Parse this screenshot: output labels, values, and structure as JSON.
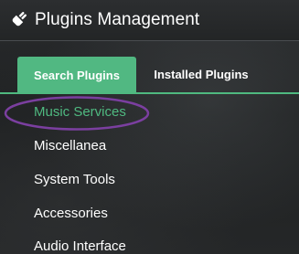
{
  "header": {
    "title": "Plugins Management",
    "icon": "plug-icon"
  },
  "tabs": [
    {
      "label": "Search Plugins",
      "active": true
    },
    {
      "label": "Installed Plugins",
      "active": false
    }
  ],
  "categories": [
    {
      "label": "Music Services",
      "active": true
    },
    {
      "label": "Miscellanea",
      "active": false
    },
    {
      "label": "System Tools",
      "active": false
    },
    {
      "label": "Accessories",
      "active": false
    },
    {
      "label": "Audio Interface",
      "active": false
    }
  ],
  "colors": {
    "accent": "#51b882",
    "highlight_annotation": "#7b3fa0",
    "text": "#ffffff"
  }
}
